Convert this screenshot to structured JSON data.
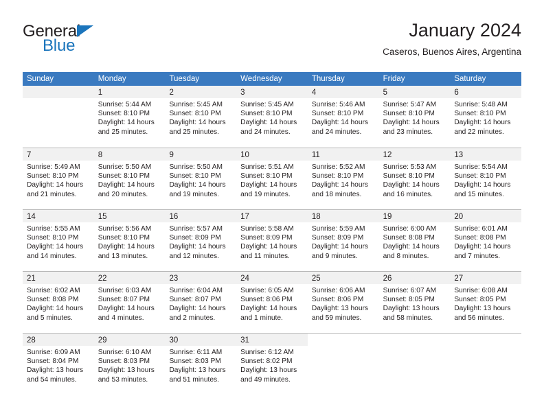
{
  "logo": {
    "word1": "General",
    "word2": "Blue",
    "triangle_color": "#1b75bc",
    "text_color": "#231f20"
  },
  "header": {
    "title": "January 2024",
    "subtitle": "Caseros, Buenos Aires, Argentina"
  },
  "theme": {
    "header_bg": "#3a7ac0",
    "header_text": "#ffffff",
    "daynum_bg": "#f1f1f1",
    "grid_line": "#b8b8b8"
  },
  "weekdays": [
    "Sunday",
    "Monday",
    "Tuesday",
    "Wednesday",
    "Thursday",
    "Friday",
    "Saturday"
  ],
  "weeks": [
    [
      {
        "day": "",
        "sunrise": "",
        "sunset": "",
        "daylight1": "",
        "daylight2": ""
      },
      {
        "day": "1",
        "sunrise": "Sunrise: 5:44 AM",
        "sunset": "Sunset: 8:10 PM",
        "daylight1": "Daylight: 14 hours",
        "daylight2": "and 25 minutes."
      },
      {
        "day": "2",
        "sunrise": "Sunrise: 5:45 AM",
        "sunset": "Sunset: 8:10 PM",
        "daylight1": "Daylight: 14 hours",
        "daylight2": "and 25 minutes."
      },
      {
        "day": "3",
        "sunrise": "Sunrise: 5:45 AM",
        "sunset": "Sunset: 8:10 PM",
        "daylight1": "Daylight: 14 hours",
        "daylight2": "and 24 minutes."
      },
      {
        "day": "4",
        "sunrise": "Sunrise: 5:46 AM",
        "sunset": "Sunset: 8:10 PM",
        "daylight1": "Daylight: 14 hours",
        "daylight2": "and 24 minutes."
      },
      {
        "day": "5",
        "sunrise": "Sunrise: 5:47 AM",
        "sunset": "Sunset: 8:10 PM",
        "daylight1": "Daylight: 14 hours",
        "daylight2": "and 23 minutes."
      },
      {
        "day": "6",
        "sunrise": "Sunrise: 5:48 AM",
        "sunset": "Sunset: 8:10 PM",
        "daylight1": "Daylight: 14 hours",
        "daylight2": "and 22 minutes."
      }
    ],
    [
      {
        "day": "7",
        "sunrise": "Sunrise: 5:49 AM",
        "sunset": "Sunset: 8:10 PM",
        "daylight1": "Daylight: 14 hours",
        "daylight2": "and 21 minutes."
      },
      {
        "day": "8",
        "sunrise": "Sunrise: 5:50 AM",
        "sunset": "Sunset: 8:10 PM",
        "daylight1": "Daylight: 14 hours",
        "daylight2": "and 20 minutes."
      },
      {
        "day": "9",
        "sunrise": "Sunrise: 5:50 AM",
        "sunset": "Sunset: 8:10 PM",
        "daylight1": "Daylight: 14 hours",
        "daylight2": "and 19 minutes."
      },
      {
        "day": "10",
        "sunrise": "Sunrise: 5:51 AM",
        "sunset": "Sunset: 8:10 PM",
        "daylight1": "Daylight: 14 hours",
        "daylight2": "and 19 minutes."
      },
      {
        "day": "11",
        "sunrise": "Sunrise: 5:52 AM",
        "sunset": "Sunset: 8:10 PM",
        "daylight1": "Daylight: 14 hours",
        "daylight2": "and 18 minutes."
      },
      {
        "day": "12",
        "sunrise": "Sunrise: 5:53 AM",
        "sunset": "Sunset: 8:10 PM",
        "daylight1": "Daylight: 14 hours",
        "daylight2": "and 16 minutes."
      },
      {
        "day": "13",
        "sunrise": "Sunrise: 5:54 AM",
        "sunset": "Sunset: 8:10 PM",
        "daylight1": "Daylight: 14 hours",
        "daylight2": "and 15 minutes."
      }
    ],
    [
      {
        "day": "14",
        "sunrise": "Sunrise: 5:55 AM",
        "sunset": "Sunset: 8:10 PM",
        "daylight1": "Daylight: 14 hours",
        "daylight2": "and 14 minutes."
      },
      {
        "day": "15",
        "sunrise": "Sunrise: 5:56 AM",
        "sunset": "Sunset: 8:10 PM",
        "daylight1": "Daylight: 14 hours",
        "daylight2": "and 13 minutes."
      },
      {
        "day": "16",
        "sunrise": "Sunrise: 5:57 AM",
        "sunset": "Sunset: 8:09 PM",
        "daylight1": "Daylight: 14 hours",
        "daylight2": "and 12 minutes."
      },
      {
        "day": "17",
        "sunrise": "Sunrise: 5:58 AM",
        "sunset": "Sunset: 8:09 PM",
        "daylight1": "Daylight: 14 hours",
        "daylight2": "and 11 minutes."
      },
      {
        "day": "18",
        "sunrise": "Sunrise: 5:59 AM",
        "sunset": "Sunset: 8:09 PM",
        "daylight1": "Daylight: 14 hours",
        "daylight2": "and 9 minutes."
      },
      {
        "day": "19",
        "sunrise": "Sunrise: 6:00 AM",
        "sunset": "Sunset: 8:08 PM",
        "daylight1": "Daylight: 14 hours",
        "daylight2": "and 8 minutes."
      },
      {
        "day": "20",
        "sunrise": "Sunrise: 6:01 AM",
        "sunset": "Sunset: 8:08 PM",
        "daylight1": "Daylight: 14 hours",
        "daylight2": "and 7 minutes."
      }
    ],
    [
      {
        "day": "21",
        "sunrise": "Sunrise: 6:02 AM",
        "sunset": "Sunset: 8:08 PM",
        "daylight1": "Daylight: 14 hours",
        "daylight2": "and 5 minutes."
      },
      {
        "day": "22",
        "sunrise": "Sunrise: 6:03 AM",
        "sunset": "Sunset: 8:07 PM",
        "daylight1": "Daylight: 14 hours",
        "daylight2": "and 4 minutes."
      },
      {
        "day": "23",
        "sunrise": "Sunrise: 6:04 AM",
        "sunset": "Sunset: 8:07 PM",
        "daylight1": "Daylight: 14 hours",
        "daylight2": "and 2 minutes."
      },
      {
        "day": "24",
        "sunrise": "Sunrise: 6:05 AM",
        "sunset": "Sunset: 8:06 PM",
        "daylight1": "Daylight: 14 hours",
        "daylight2": "and 1 minute."
      },
      {
        "day": "25",
        "sunrise": "Sunrise: 6:06 AM",
        "sunset": "Sunset: 8:06 PM",
        "daylight1": "Daylight: 13 hours",
        "daylight2": "and 59 minutes."
      },
      {
        "day": "26",
        "sunrise": "Sunrise: 6:07 AM",
        "sunset": "Sunset: 8:05 PM",
        "daylight1": "Daylight: 13 hours",
        "daylight2": "and 58 minutes."
      },
      {
        "day": "27",
        "sunrise": "Sunrise: 6:08 AM",
        "sunset": "Sunset: 8:05 PM",
        "daylight1": "Daylight: 13 hours",
        "daylight2": "and 56 minutes."
      }
    ],
    [
      {
        "day": "28",
        "sunrise": "Sunrise: 6:09 AM",
        "sunset": "Sunset: 8:04 PM",
        "daylight1": "Daylight: 13 hours",
        "daylight2": "and 54 minutes."
      },
      {
        "day": "29",
        "sunrise": "Sunrise: 6:10 AM",
        "sunset": "Sunset: 8:03 PM",
        "daylight1": "Daylight: 13 hours",
        "daylight2": "and 53 minutes."
      },
      {
        "day": "30",
        "sunrise": "Sunrise: 6:11 AM",
        "sunset": "Sunset: 8:03 PM",
        "daylight1": "Daylight: 13 hours",
        "daylight2": "and 51 minutes."
      },
      {
        "day": "31",
        "sunrise": "Sunrise: 6:12 AM",
        "sunset": "Sunset: 8:02 PM",
        "daylight1": "Daylight: 13 hours",
        "daylight2": "and 49 minutes."
      },
      {
        "day": "",
        "sunrise": "",
        "sunset": "",
        "daylight1": "",
        "daylight2": ""
      },
      {
        "day": "",
        "sunrise": "",
        "sunset": "",
        "daylight1": "",
        "daylight2": ""
      },
      {
        "day": "",
        "sunrise": "",
        "sunset": "",
        "daylight1": "",
        "daylight2": ""
      }
    ]
  ]
}
